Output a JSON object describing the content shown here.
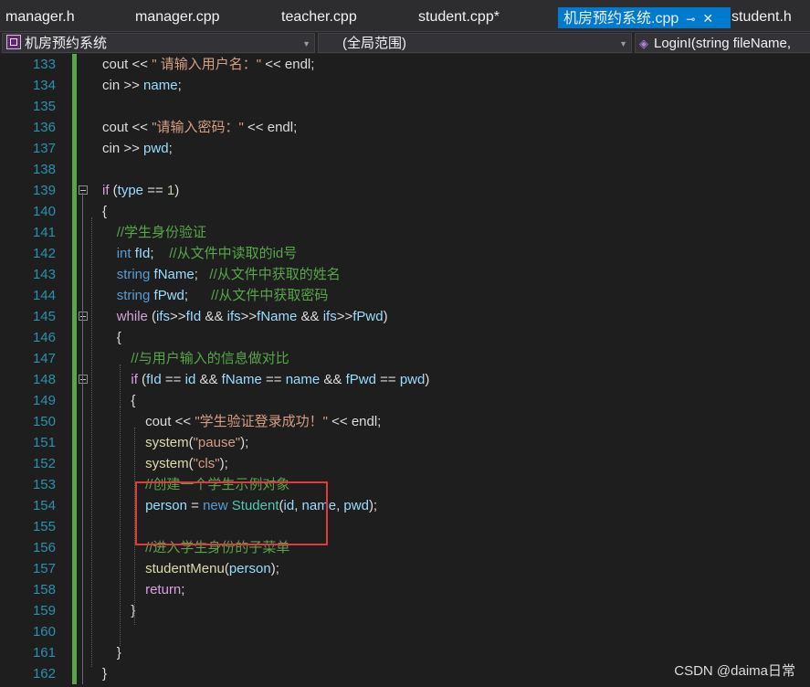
{
  "tabs": [
    {
      "label": "manager.h",
      "active": false
    },
    {
      "label": "manager.cpp",
      "active": false
    },
    {
      "label": "teacher.cpp",
      "active": false
    },
    {
      "label": "student.cpp*",
      "active": false
    },
    {
      "label": "机房预约系统.cpp",
      "active": true
    },
    {
      "label": "student.h",
      "active": false
    }
  ],
  "tab_pin_glyph": "⊸",
  "tab_close_glyph": "✕",
  "navbar": {
    "project": "机房预约系统",
    "scope": "(全局范围)",
    "member": "LoginI(string fileName,"
  },
  "colors": {
    "keyword": "#569cd6",
    "control": "#d8a0df",
    "string": "#d69d85",
    "comment": "#57a64a",
    "variable": "#9cdcfe",
    "type": "#4ec9b0",
    "highlight_box": "#e03a3a",
    "active_tab": "#007acc"
  },
  "lines": [
    {
      "n": "133",
      "indent": 0,
      "tokens": [
        [
          "text",
          "cout << "
        ],
        [
          "str",
          "\" 请输入用户名：\""
        ],
        [
          "text",
          " << endl;"
        ]
      ]
    },
    {
      "n": "134",
      "indent": 0,
      "tokens": [
        [
          "text",
          "cin >> "
        ],
        [
          "var",
          "name"
        ],
        [
          "text",
          ";"
        ]
      ]
    },
    {
      "n": "135",
      "indent": 0,
      "tokens": []
    },
    {
      "n": "136",
      "indent": 0,
      "tokens": [
        [
          "text",
          "cout << "
        ],
        [
          "str",
          "\"请输入密码：\""
        ],
        [
          "text",
          " << endl;"
        ]
      ]
    },
    {
      "n": "137",
      "indent": 0,
      "tokens": [
        [
          "text",
          "cin >> "
        ],
        [
          "var",
          "pwd"
        ],
        [
          "text",
          ";"
        ]
      ]
    },
    {
      "n": "138",
      "indent": 0,
      "tokens": []
    },
    {
      "n": "139",
      "indent": 0,
      "fold": true,
      "tokens": [
        [
          "ctl",
          "if"
        ],
        [
          "text",
          " ("
        ],
        [
          "var",
          "type"
        ],
        [
          "text",
          " == "
        ],
        [
          "num",
          "1"
        ],
        [
          "text",
          ")"
        ]
      ]
    },
    {
      "n": "140",
      "indent": 0,
      "tokens": [
        [
          "text",
          "{"
        ]
      ]
    },
    {
      "n": "141",
      "indent": 1,
      "tokens": [
        [
          "cmt",
          "//学生身份验证"
        ]
      ]
    },
    {
      "n": "142",
      "indent": 1,
      "tokens": [
        [
          "kw",
          "int"
        ],
        [
          "text",
          " "
        ],
        [
          "var",
          "fId"
        ],
        [
          "text",
          ";    "
        ],
        [
          "cmt",
          "//从文件中读取的id号"
        ]
      ]
    },
    {
      "n": "143",
      "indent": 1,
      "tokens": [
        [
          "kw",
          "string"
        ],
        [
          "text",
          " "
        ],
        [
          "var",
          "fName"
        ],
        [
          "text",
          ";   "
        ],
        [
          "cmt",
          "//从文件中获取的姓名"
        ]
      ]
    },
    {
      "n": "144",
      "indent": 1,
      "tokens": [
        [
          "kw",
          "string"
        ],
        [
          "text",
          " "
        ],
        [
          "var",
          "fPwd"
        ],
        [
          "text",
          ";      "
        ],
        [
          "cmt",
          "//从文件中获取密码"
        ]
      ]
    },
    {
      "n": "145",
      "indent": 1,
      "fold": true,
      "tokens": [
        [
          "ctl",
          "while"
        ],
        [
          "text",
          " ("
        ],
        [
          "var",
          "ifs"
        ],
        [
          "text",
          ">>"
        ],
        [
          "var",
          "fId"
        ],
        [
          "text",
          " && "
        ],
        [
          "var",
          "ifs"
        ],
        [
          "text",
          ">>"
        ],
        [
          "var",
          "fName"
        ],
        [
          "text",
          " && "
        ],
        [
          "var",
          "ifs"
        ],
        [
          "text",
          ">>"
        ],
        [
          "var",
          "fPwd"
        ],
        [
          "text",
          ")"
        ]
      ]
    },
    {
      "n": "146",
      "indent": 1,
      "tokens": [
        [
          "text",
          "{"
        ]
      ]
    },
    {
      "n": "147",
      "indent": 2,
      "tokens": [
        [
          "cmt",
          "//与用户输入的信息做对比"
        ]
      ]
    },
    {
      "n": "148",
      "indent": 2,
      "fold": true,
      "tokens": [
        [
          "ctl",
          "if"
        ],
        [
          "text",
          " ("
        ],
        [
          "var",
          "fId"
        ],
        [
          "text",
          " == "
        ],
        [
          "var",
          "id"
        ],
        [
          "text",
          " && "
        ],
        [
          "var",
          "fName"
        ],
        [
          "text",
          " == "
        ],
        [
          "var",
          "name"
        ],
        [
          "text",
          " && "
        ],
        [
          "var",
          "fPwd"
        ],
        [
          "text",
          " == "
        ],
        [
          "var",
          "pwd"
        ],
        [
          "text",
          ")"
        ]
      ]
    },
    {
      "n": "149",
      "indent": 2,
      "tokens": [
        [
          "text",
          "{"
        ]
      ]
    },
    {
      "n": "150",
      "indent": 3,
      "tokens": [
        [
          "text",
          "cout << "
        ],
        [
          "str",
          "\"学生验证登录成功！\""
        ],
        [
          "text",
          " << endl;"
        ]
      ]
    },
    {
      "n": "151",
      "indent": 3,
      "tokens": [
        [
          "fn",
          "system"
        ],
        [
          "text",
          "("
        ],
        [
          "str",
          "\"pause\""
        ],
        [
          "text",
          ");"
        ]
      ]
    },
    {
      "n": "152",
      "indent": 3,
      "tokens": [
        [
          "fn",
          "system"
        ],
        [
          "text",
          "("
        ],
        [
          "str",
          "\"cls\""
        ],
        [
          "text",
          ");"
        ]
      ]
    },
    {
      "n": "153",
      "indent": 3,
      "tokens": [
        [
          "cmt",
          "//创建一个学生示例对象"
        ]
      ]
    },
    {
      "n": "154",
      "indent": 3,
      "tokens": [
        [
          "var",
          "person"
        ],
        [
          "text",
          " = "
        ],
        [
          "kw",
          "new"
        ],
        [
          "text",
          " "
        ],
        [
          "type",
          "Student"
        ],
        [
          "text",
          "("
        ],
        [
          "var",
          "id"
        ],
        [
          "text",
          ", "
        ],
        [
          "var",
          "name"
        ],
        [
          "text",
          ", "
        ],
        [
          "var",
          "pwd"
        ],
        [
          "text",
          ");"
        ]
      ]
    },
    {
      "n": "155",
      "indent": 3,
      "tokens": []
    },
    {
      "n": "156",
      "indent": 3,
      "tokens": [
        [
          "cmt",
          "//进入学生身份的子菜单"
        ]
      ]
    },
    {
      "n": "157",
      "indent": 3,
      "tokens": [
        [
          "fn",
          "studentMenu"
        ],
        [
          "text",
          "("
        ],
        [
          "var",
          "person"
        ],
        [
          "text",
          ");"
        ]
      ]
    },
    {
      "n": "158",
      "indent": 3,
      "tokens": [
        [
          "ctl",
          "return"
        ],
        [
          "text",
          ";"
        ]
      ]
    },
    {
      "n": "159",
      "indent": 2,
      "tokens": [
        [
          "text",
          "}"
        ]
      ]
    },
    {
      "n": "160",
      "indent": 2,
      "tokens": []
    },
    {
      "n": "161",
      "indent": 1,
      "tokens": [
        [
          "text",
          "}"
        ]
      ]
    },
    {
      "n": "162",
      "indent": 0,
      "tokens": [
        [
          "text",
          "}"
        ]
      ]
    }
  ],
  "watermark": "CSDN @daima日常"
}
